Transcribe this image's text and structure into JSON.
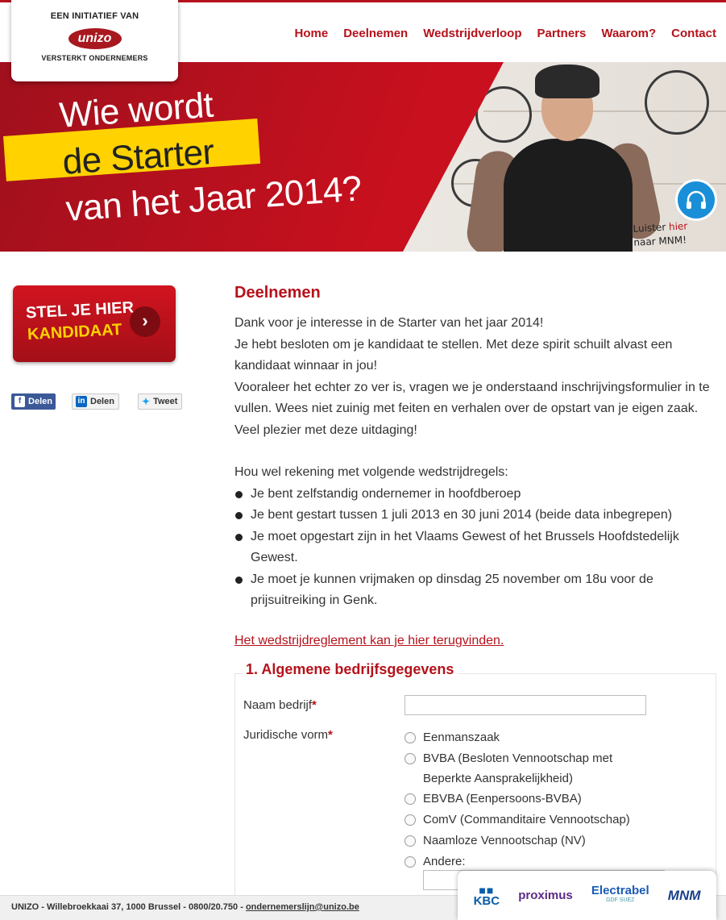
{
  "header": {
    "logo_top": "EEN INITIATIEF VAN",
    "logo_name": "unizo",
    "logo_bottom": "VERSTERKT ONDERNEMERS",
    "nav": [
      "Home",
      "Deelnemen",
      "Wedstrijdverloop",
      "Partners",
      "Waarom?",
      "Contact"
    ]
  },
  "hero": {
    "line1": "Wie wordt",
    "line2": "de Starter",
    "line3": "van het Jaar 2014?",
    "mnm_line1_a": "Luister ",
    "mnm_line1_b": "hier",
    "mnm_line2": "naar MNM!",
    "mnm_icon": "headphones-icon"
  },
  "sidebar": {
    "cta_line1": "STEL JE HIER",
    "cta_line2": "KANDIDAAT",
    "share": [
      {
        "label": "Delen",
        "icon": "facebook-icon"
      },
      {
        "label": "Delen",
        "icon": "linkedin-icon"
      },
      {
        "label": "Tweet",
        "icon": "twitter-icon"
      }
    ]
  },
  "main": {
    "title": "Deelnemen",
    "p1": "Dank voor je interesse in de Starter van het jaar 2014!",
    "p2": "Je hebt besloten om je kandidaat te stellen. Met deze spirit schuilt alvast een kandidaat winnaar in jou!",
    "p3": "Vooraleer het echter zo ver is, vragen we je onderstaand inschrijvingsformulier in te vullen. Wees niet zuinig met feiten en verhalen over de opstart van je eigen zaak. Veel plezier met deze uitdaging!",
    "rules_title": "Hou wel rekening met volgende wedstrijdregels:",
    "rules": [
      "Je bent zelfstandig ondernemer in hoofdberoep",
      "Je bent gestart tussen 1 juli 2013 en 30 juni 2014 (beide data inbegrepen)",
      "Je moet opgestart zijn in het Vlaams Gewest of het Brussels Hoofdstedelijk Gewest.",
      "Je moet je kunnen vrijmaken op dinsdag 25 november om 18u voor de prijsuitreiking in Genk."
    ],
    "link": "Het wedstrijdreglement kan je hier terugvinden."
  },
  "form": {
    "legend": "1. Algemene bedrijfsgegevens",
    "company_label": "Naam bedrijf",
    "company_value": "",
    "legal_label": "Juridische vorm",
    "required_mark": "*",
    "options": [
      "Eenmanszaak",
      "BVBA (Besloten Vennootschap met Beperkte Aansprakelijkheid)",
      "EBVBA (Eenpersoons-BVBA)",
      "ComV (Commanditaire Vennootschap)",
      "Naamloze Vennootschap (NV)",
      "Andere:"
    ],
    "other_value": ""
  },
  "footer": {
    "address": "UNIZO - Willebroekkaai 37, 1000 Brussel - 0800/20.750 - ",
    "email": "ondernemerslijn@unizo.be",
    "partners": {
      "kbc": "KBC",
      "proximus": "proximus",
      "electrabel": "Electrabel",
      "electrabel_sub": "GDF SUEZ",
      "mnm": "MNM"
    }
  },
  "colors": {
    "brand_red": "#b5121b",
    "accent_yellow": "#ffd200",
    "facebook": "#3b5998"
  }
}
